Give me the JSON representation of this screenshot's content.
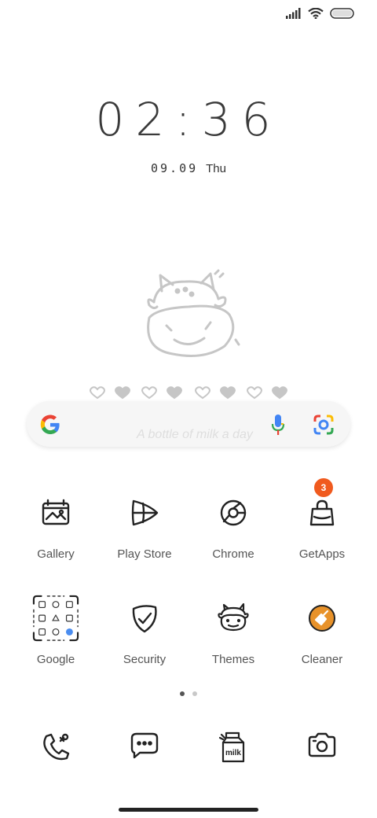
{
  "status_bar": {
    "signal_icon": "signal-bars-icon",
    "wifi_icon": "wifi-icon",
    "battery_icon": "battery-icon"
  },
  "clock": {
    "time": "02:36",
    "date": "09.09",
    "day": "Thu"
  },
  "widget": {
    "illustration": "cow-face-icon",
    "hint_text": "A bottle of milk a day"
  },
  "search": {
    "logo": "google-g-icon",
    "voice_icon": "mic-icon",
    "lens_icon": "lens-camera-icon"
  },
  "apps": [
    {
      "label": "Gallery",
      "icon": "gallery-icon"
    },
    {
      "label": "Play Store",
      "icon": "play-store-icon"
    },
    {
      "label": "Chrome",
      "icon": "chrome-icon"
    },
    {
      "label": "GetApps",
      "icon": "getapps-bag-icon",
      "badge": "3"
    },
    {
      "label": "Google",
      "icon": "google-folder-icon"
    },
    {
      "label": "Security",
      "icon": "security-shield-icon"
    },
    {
      "label": "Themes",
      "icon": "themes-cow-icon"
    },
    {
      "label": "Cleaner",
      "icon": "cleaner-broom-icon"
    }
  ],
  "page_indicator": {
    "current": 1,
    "total": 2
  },
  "dock": [
    {
      "icon": "phone-icon"
    },
    {
      "icon": "messages-icon"
    },
    {
      "icon": "milk-carton-icon",
      "text": "milk"
    },
    {
      "icon": "camera-icon"
    }
  ],
  "colors": {
    "badge": "#f05a1e",
    "cleaner": "#e8922a",
    "text": "#555555"
  }
}
